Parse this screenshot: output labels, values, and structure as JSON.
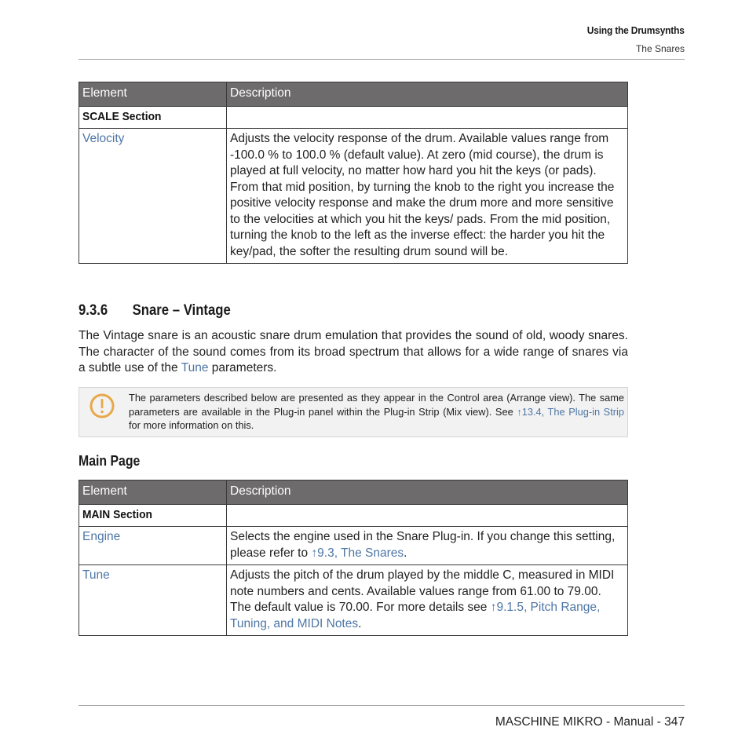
{
  "header": {
    "chapter": "Using the Drumsynths",
    "section": "The Snares"
  },
  "table1": {
    "columns": [
      "Element",
      "Description"
    ],
    "section_label": "SCALE Section",
    "rows": [
      {
        "element": "Velocity",
        "description": "Adjusts the velocity response of the drum. Available values range from -100.0 % to 100.0 % (default value). At zero (mid course), the drum is played at full velocity, no matter how hard you hit the keys (or pads). From that mid position, by turning the knob to the right you increase the positive velocity response and make the drum more and more sensitive to the velocities at which you hit the keys/ pads. From the mid position, turning the knob to the left as the inverse effect: the harder you hit the key/pad, the softer the resulting drum sound will be."
      }
    ]
  },
  "section": {
    "number": "9.3.6",
    "title": "Snare – Vintage",
    "intro_before_link": "The Vintage snare is an acoustic snare drum emulation that provides the sound of old, woody snares. The character of the sound comes from its broad spectrum that allows for a wide range of snares via a subtle use of the ",
    "intro_link": "Tune",
    "intro_after_link": " parameters."
  },
  "note": {
    "icon": "warning-circle-icon",
    "text_before_link": "The parameters described below are presented as they appear in the Control area (Arrange view). The same parameters are available in the Plug-in panel within the Plug-in Strip (Mix view). See ",
    "link": "↑13.4, The Plug-in Strip",
    "text_after_link": " for more information on this.",
    "accent_color": "#e8a84a"
  },
  "subsection": {
    "title": "Main Page"
  },
  "table2": {
    "columns": [
      "Element",
      "Description"
    ],
    "section_label": "MAIN Section",
    "rows": [
      {
        "element": "Engine",
        "description_before_link": "Selects the engine used in the Snare Plug-in. If you change this setting, please refer to ",
        "link": "↑9.3, The Snares",
        "description_after_link": "."
      },
      {
        "element": "Tune",
        "description_before_link": "Adjusts the pitch of the drum played by the middle C, measured in MIDI note numbers and cents. Available values range from 61.00 to 79.00. The default value is 70.00. For more details see ",
        "link": "↑9.1.5, Pitch Range, Tuning, and MIDI Notes",
        "description_after_link": "."
      }
    ]
  },
  "footer": {
    "text": "MASCHINE MIKRO - Manual - 347"
  },
  "colors": {
    "link": "#4e76a6",
    "table_header_bg": "#6d6b6c",
    "note_bg": "#f2f2f2"
  }
}
